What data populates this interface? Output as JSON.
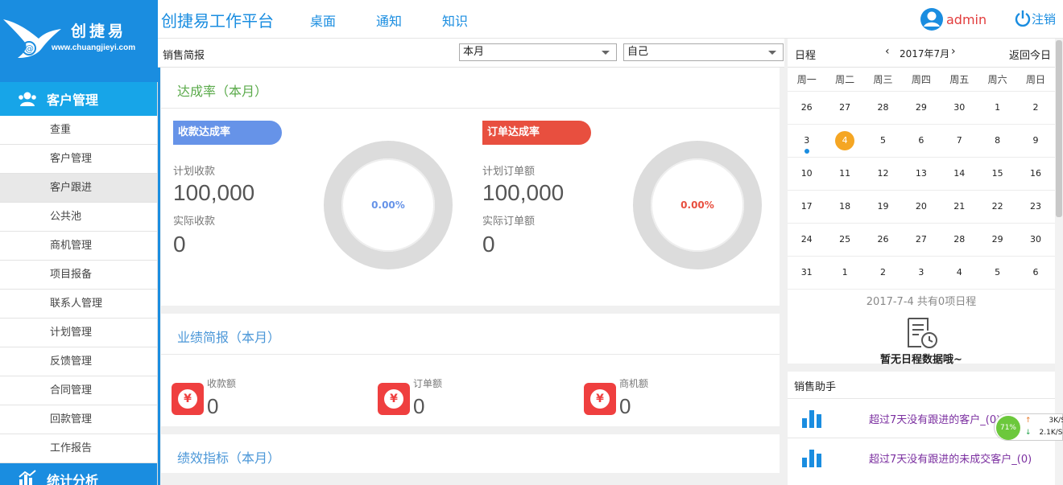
{
  "logo": {
    "brand": "创捷易",
    "site": "www.chuangjieyi.com"
  },
  "header": {
    "app_title": "创捷易工作平台",
    "nav": [
      "桌面",
      "通知",
      "知识"
    ],
    "user_name": "admin",
    "logout": "注销"
  },
  "sidebar": {
    "section1": "客户管理",
    "items": [
      "查重",
      "客户管理",
      "客户跟进",
      "公共池",
      "商机管理",
      "项目报备",
      "联系人管理",
      "计划管理",
      "反馈管理",
      "合同管理",
      "回款管理",
      "工作报告"
    ],
    "active_index": 2,
    "section2": "统计分析"
  },
  "subbar": {
    "label": "销售简报",
    "period": "本月",
    "scope": "自己"
  },
  "achievement": {
    "title": "达成率（本月）",
    "payment": {
      "pill": "收款达成率",
      "plan_label": "计划收款",
      "plan_value": "100,000",
      "actual_label": "实际收款",
      "actual_value": "0",
      "rate": "0.00%",
      "color": "#6693e8"
    },
    "order": {
      "pill": "订单达成率",
      "plan_label": "计划订单额",
      "plan_value": "100,000",
      "actual_label": "实际订单额",
      "actual_value": "0",
      "rate": "0.00%",
      "color": "#e84f3f"
    }
  },
  "performance": {
    "title": "业绩简报（本月）",
    "items": [
      {
        "label": "收款额",
        "value": "0"
      },
      {
        "label": "订单额",
        "value": "0"
      },
      {
        "label": "商机额",
        "value": "0"
      }
    ],
    "icon": "yen-icon"
  },
  "kpi": {
    "title": "绩效指标（本月）"
  },
  "calendar": {
    "title": "日程",
    "prev": "‹",
    "month": "2017年7月",
    "next": "›",
    "today_btn": "返回今日",
    "weekdays": [
      "周一",
      "周二",
      "周三",
      "周四",
      "周五",
      "周六",
      "周日"
    ],
    "weeks": [
      [
        "26",
        "27",
        "28",
        "29",
        "30",
        "1",
        "2"
      ],
      [
        "3",
        "4",
        "5",
        "6",
        "7",
        "8",
        "9"
      ],
      [
        "10",
        "11",
        "12",
        "13",
        "14",
        "15",
        "16"
      ],
      [
        "17",
        "18",
        "19",
        "20",
        "21",
        "22",
        "23"
      ],
      [
        "24",
        "25",
        "26",
        "27",
        "28",
        "29",
        "30"
      ],
      [
        "31",
        "1",
        "2",
        "3",
        "4",
        "5",
        "6"
      ]
    ],
    "current_day": "4",
    "dot_day": "3",
    "info": "2017-7-4 共有0项日程",
    "empty": "暂无日程数据哦~"
  },
  "assistant": {
    "title": "销售助手",
    "links": [
      "超过7天没有跟进的客户_(0)",
      "超过7天没有跟进的未成交客户_(0)"
    ]
  },
  "network": {
    "percent": "71%",
    "up": "3K/S",
    "down": "2.1K/S"
  },
  "colors": {
    "brand": "#1a8de0",
    "sidebar_head": "#17a5e8",
    "accent_orange": "#f5a623",
    "yen_red": "#ef3f3f"
  }
}
